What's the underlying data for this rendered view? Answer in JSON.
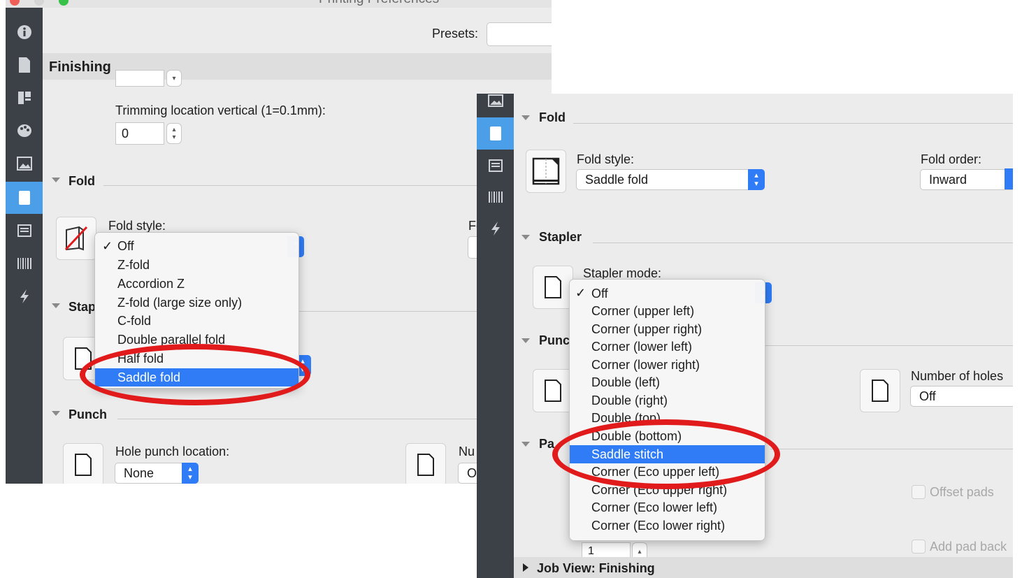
{
  "left": {
    "window_title": "Printing Preferences",
    "presets_label": "Presets:",
    "section_title": "Finishing",
    "trimming_label": "Trimming location vertical (1=0.1mm):",
    "trimming_value": "0",
    "fold_header": "Fold",
    "fold_style_label": "Fold style:",
    "fold_order_label_partial": "Fo",
    "stapler_header_partial": "Stap",
    "punch_header": "Punch",
    "hole_punch_label": "Hole punch location:",
    "hole_punch_value": "None",
    "number_holes_partial": "Nu",
    "number_holes_value_partial": "O",
    "fold_menu": {
      "checked": "✓",
      "items": [
        "Off",
        "Z-fold",
        "Accordion Z",
        "Z-fold (large size only)",
        "C-fold",
        "Double parallel fold",
        "Half fold",
        "Saddle fold"
      ],
      "selected_index": 7
    }
  },
  "right": {
    "fold_header": "Fold",
    "fold_style_label": "Fold style:",
    "fold_style_value": "Saddle fold",
    "fold_order_label": "Fold order:",
    "fold_order_value": "Inward",
    "stapler_header": "Stapler",
    "stapler_mode_label": "Stapler mode:",
    "punch_header_partial": "Punc",
    "number_holes_label": "Number of holes",
    "number_holes_value": "Off",
    "pad_header_partial": "Pa",
    "offset_pads": "Offset pads",
    "add_pad_back": "Add pad back",
    "stepper_value": "1",
    "job_view": "Job View: Finishing",
    "stapler_menu": {
      "checked": "✓",
      "items": [
        "Off",
        "Corner (upper left)",
        "Corner (upper right)",
        "Corner (lower left)",
        "Corner (lower right)",
        "Double (left)",
        "Double (right)",
        "Double (top)",
        "Double (bottom)",
        "Saddle stitch",
        "Corner (Eco upper left)",
        "Corner (Eco upper right)",
        "Corner (Eco lower left)",
        "Corner (Eco lower right)"
      ],
      "selected_index": 9
    }
  },
  "colors": {
    "accent": "#2f7cf6",
    "sidebar": "#3c4147",
    "highlight_ring": "#e11b1b"
  }
}
